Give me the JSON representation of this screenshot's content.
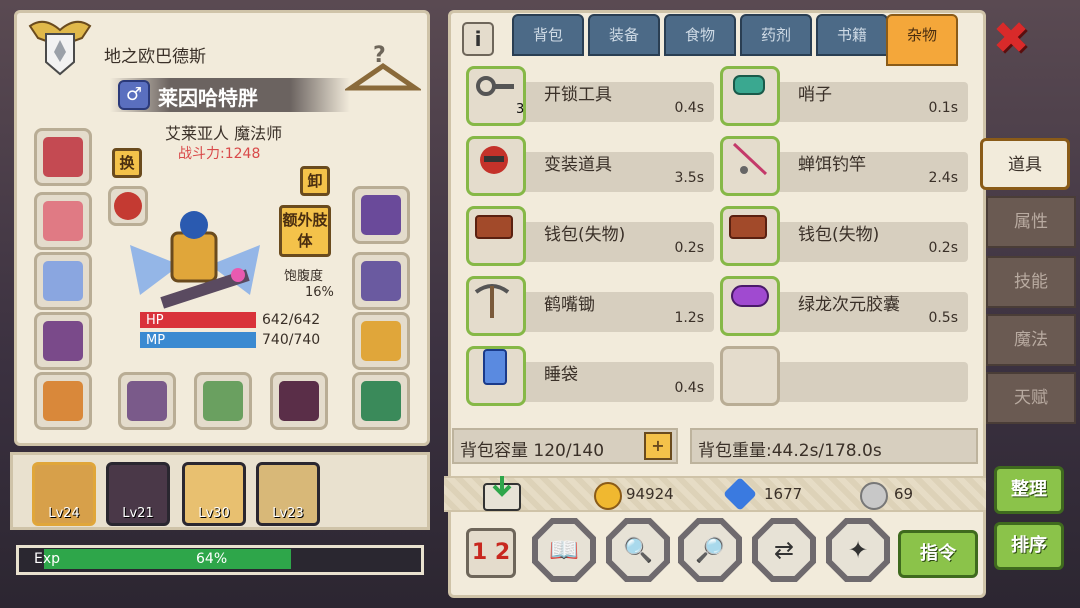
{
  "hero": {
    "title": "地之欧巴德斯",
    "name": "莱因哈特胖",
    "gender_symbol": "♂",
    "race_class": "艾莱亚人 魔法师",
    "power": "战斗力:1248",
    "swap_label": "换",
    "unequip_label": "卸",
    "extra_limb_label": "额外肢体",
    "satiety_label": "饱腹度",
    "satiety_value": "16%",
    "hp_label": "HP",
    "hp_value": "642/642",
    "mp_label": "MP",
    "mp_value": "740/740"
  },
  "party": [
    {
      "level": "Lv24"
    },
    {
      "level": "Lv21"
    },
    {
      "level": "Lv30"
    },
    {
      "level": "Lv23"
    }
  ],
  "exp": {
    "label": "Exp",
    "value": "64%",
    "fraction": 0.64
  },
  "tabs": [
    "背包",
    "装备",
    "食物",
    "药剂",
    "书籍",
    "杂物"
  ],
  "active_tab": "杂物",
  "items": [
    {
      "name": "开锁工具",
      "weight": "0.4s",
      "qty": "3"
    },
    {
      "name": "哨子",
      "weight": "0.1s",
      "qty": ""
    },
    {
      "name": "变装道具",
      "weight": "3.5s",
      "qty": ""
    },
    {
      "name": "蝉饵钓竿",
      "weight": "2.4s",
      "qty": ""
    },
    {
      "name": "钱包(失物)",
      "weight": "0.2s",
      "qty": ""
    },
    {
      "name": "钱包(失物)",
      "weight": "0.2s",
      "qty": ""
    },
    {
      "name": "鹤嘴锄",
      "weight": "1.2s",
      "qty": ""
    },
    {
      "name": "绿龙次元胶囊",
      "weight": "0.5s",
      "qty": ""
    },
    {
      "name": "睡袋",
      "weight": "0.4s",
      "qty": ""
    }
  ],
  "capacity": "背包容量 120/140",
  "capacity_plus": "+",
  "weight": "背包重量:44.2s/178.0s",
  "currency": {
    "gold": "94924",
    "gem": "1677",
    "silver": "69"
  },
  "sort_icon": "1 2",
  "command_label": "指令",
  "side_buttons": {
    "organize": "整理",
    "sort": "排序"
  },
  "vtabs": [
    "道具",
    "属性",
    "技能",
    "魔法",
    "天赋"
  ],
  "info_label": "i",
  "close_label": "✖",
  "colors": {
    "tab_active": "#f4a73a",
    "tab_inactive": "#4c6a87",
    "hp": "#d9323a",
    "mp": "#3b8ad1",
    "exp": "#2ea64a",
    "item_border": "#86b847"
  }
}
